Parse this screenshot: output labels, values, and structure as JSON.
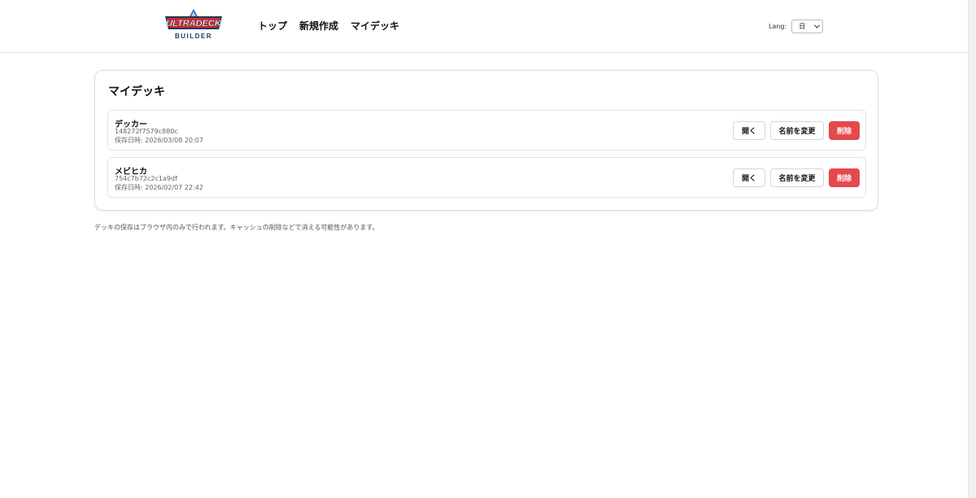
{
  "header": {
    "logo": {
      "main": "ULTRADECK",
      "sub": "BUILDER"
    },
    "nav": [
      "トップ",
      "新規作成",
      "マイデッキ"
    ],
    "lang": {
      "label": "Lang:",
      "selected": "日"
    }
  },
  "main": {
    "title": "マイデッキ",
    "decks": [
      {
        "name": "デッカー",
        "id": "148272f7579c880c",
        "saved": "保存日時: 2026/03/08 20:07"
      },
      {
        "name": "メビヒカ",
        "id": "754c7b72c2c1a9df",
        "saved": "保存日時: 2026/02/07 22:42"
      }
    ],
    "actions": {
      "open": "開く",
      "rename": "名前を変更",
      "delete": "削除"
    }
  },
  "footer": {
    "note": "デッキの保存はブラウザ内のみで行われます。キャッシュの削除などで消える可能性があります。"
  },
  "colors": {
    "accent_red": "#e5484d",
    "logo_red": "#d62828",
    "logo_blue": "#1d3a5c"
  },
  "icons": {
    "lang_dropdown": "chevron-down-icon"
  }
}
